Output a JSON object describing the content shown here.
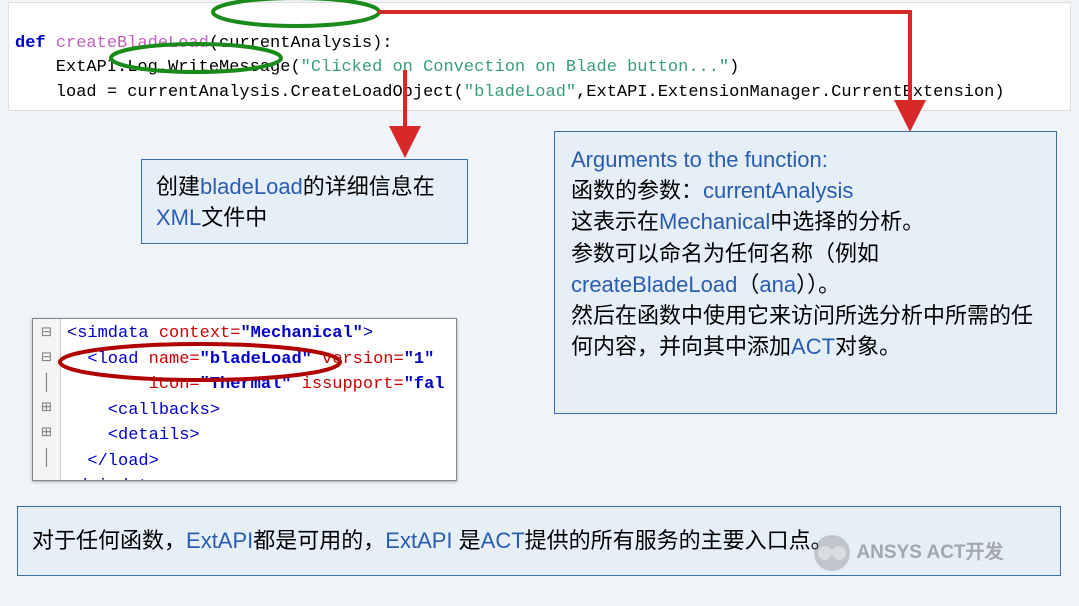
{
  "code": {
    "kw_def": "def",
    "fn_name": "createBladeLoad",
    "arg": "currentAnalysis",
    "colon": ":",
    "line2_pre": "    ExtAPI.Log.WriteMessage(",
    "line2_str": "\"Clicked on Convection on Blade button...\"",
    "line2_post": ")",
    "line3_pre": "    load = ",
    "line3_mid": "currentAnalysis.",
    "line3_call": "CreateLoadObject(",
    "line3_str": "\"bladeLoad\"",
    "line3_rest": ",ExtAPI.ExtensionManager.CurrentExtension)"
  },
  "box1": {
    "t1": "创建",
    "t2": "bladeLoad",
    "t3": "的详细信息在",
    "t4": "XML",
    "t5": "文件中"
  },
  "box2": {
    "title": "Arguments to the function:",
    "l2a": "函数的参数：",
    "l2b": "currentAnalysis",
    "l3a": "这表示在",
    "l3b": "Mechanical",
    "l3c": "中选择的分析。",
    "l4": "参数可以命名为任何名称（例如",
    "l5a": "createBladeLoad",
    "l5b": "（",
    "l5c": "ana",
    "l5d": "））。",
    "l6": "然后在函数中使用它来访问所选分析中所需的任何内容，并向其中添加",
    "l7a": "ACT",
    "l7b": "对象。"
  },
  "box3": {
    "t1": "对于任何函数，",
    "t2": "ExtAPI",
    "t3": "都是可用的，",
    "t4": "ExtAPI ",
    "t5": "是",
    "t6": "ACT",
    "t7": "提供的所有服务的主要入口点。"
  },
  "xml": {
    "l1_open": "<simdata",
    "l1_attr": " context=",
    "l1_val": "\"Mechanical\"",
    "l1_close": ">",
    "l2_indent": "  ",
    "l2_open": "<load",
    "l2_name_attr": " name=",
    "l2_name_val": "\"bladeLoad\"",
    "l2_ver_attr": " version=",
    "l2_ver_val": "\"1\"",
    "l3_indent": "        ",
    "l3_icon_attr": "icon=",
    "l3_icon_val": "\"Thermal\"",
    "l3_sup_attr": " issupport=",
    "l3_sup_val": "\"fal",
    "l4": "    <callbacks>",
    "l5": "    <details>",
    "l6": "  </load>",
    "l7": "</simdata>"
  },
  "watermark": "ANSYS ACT开发"
}
